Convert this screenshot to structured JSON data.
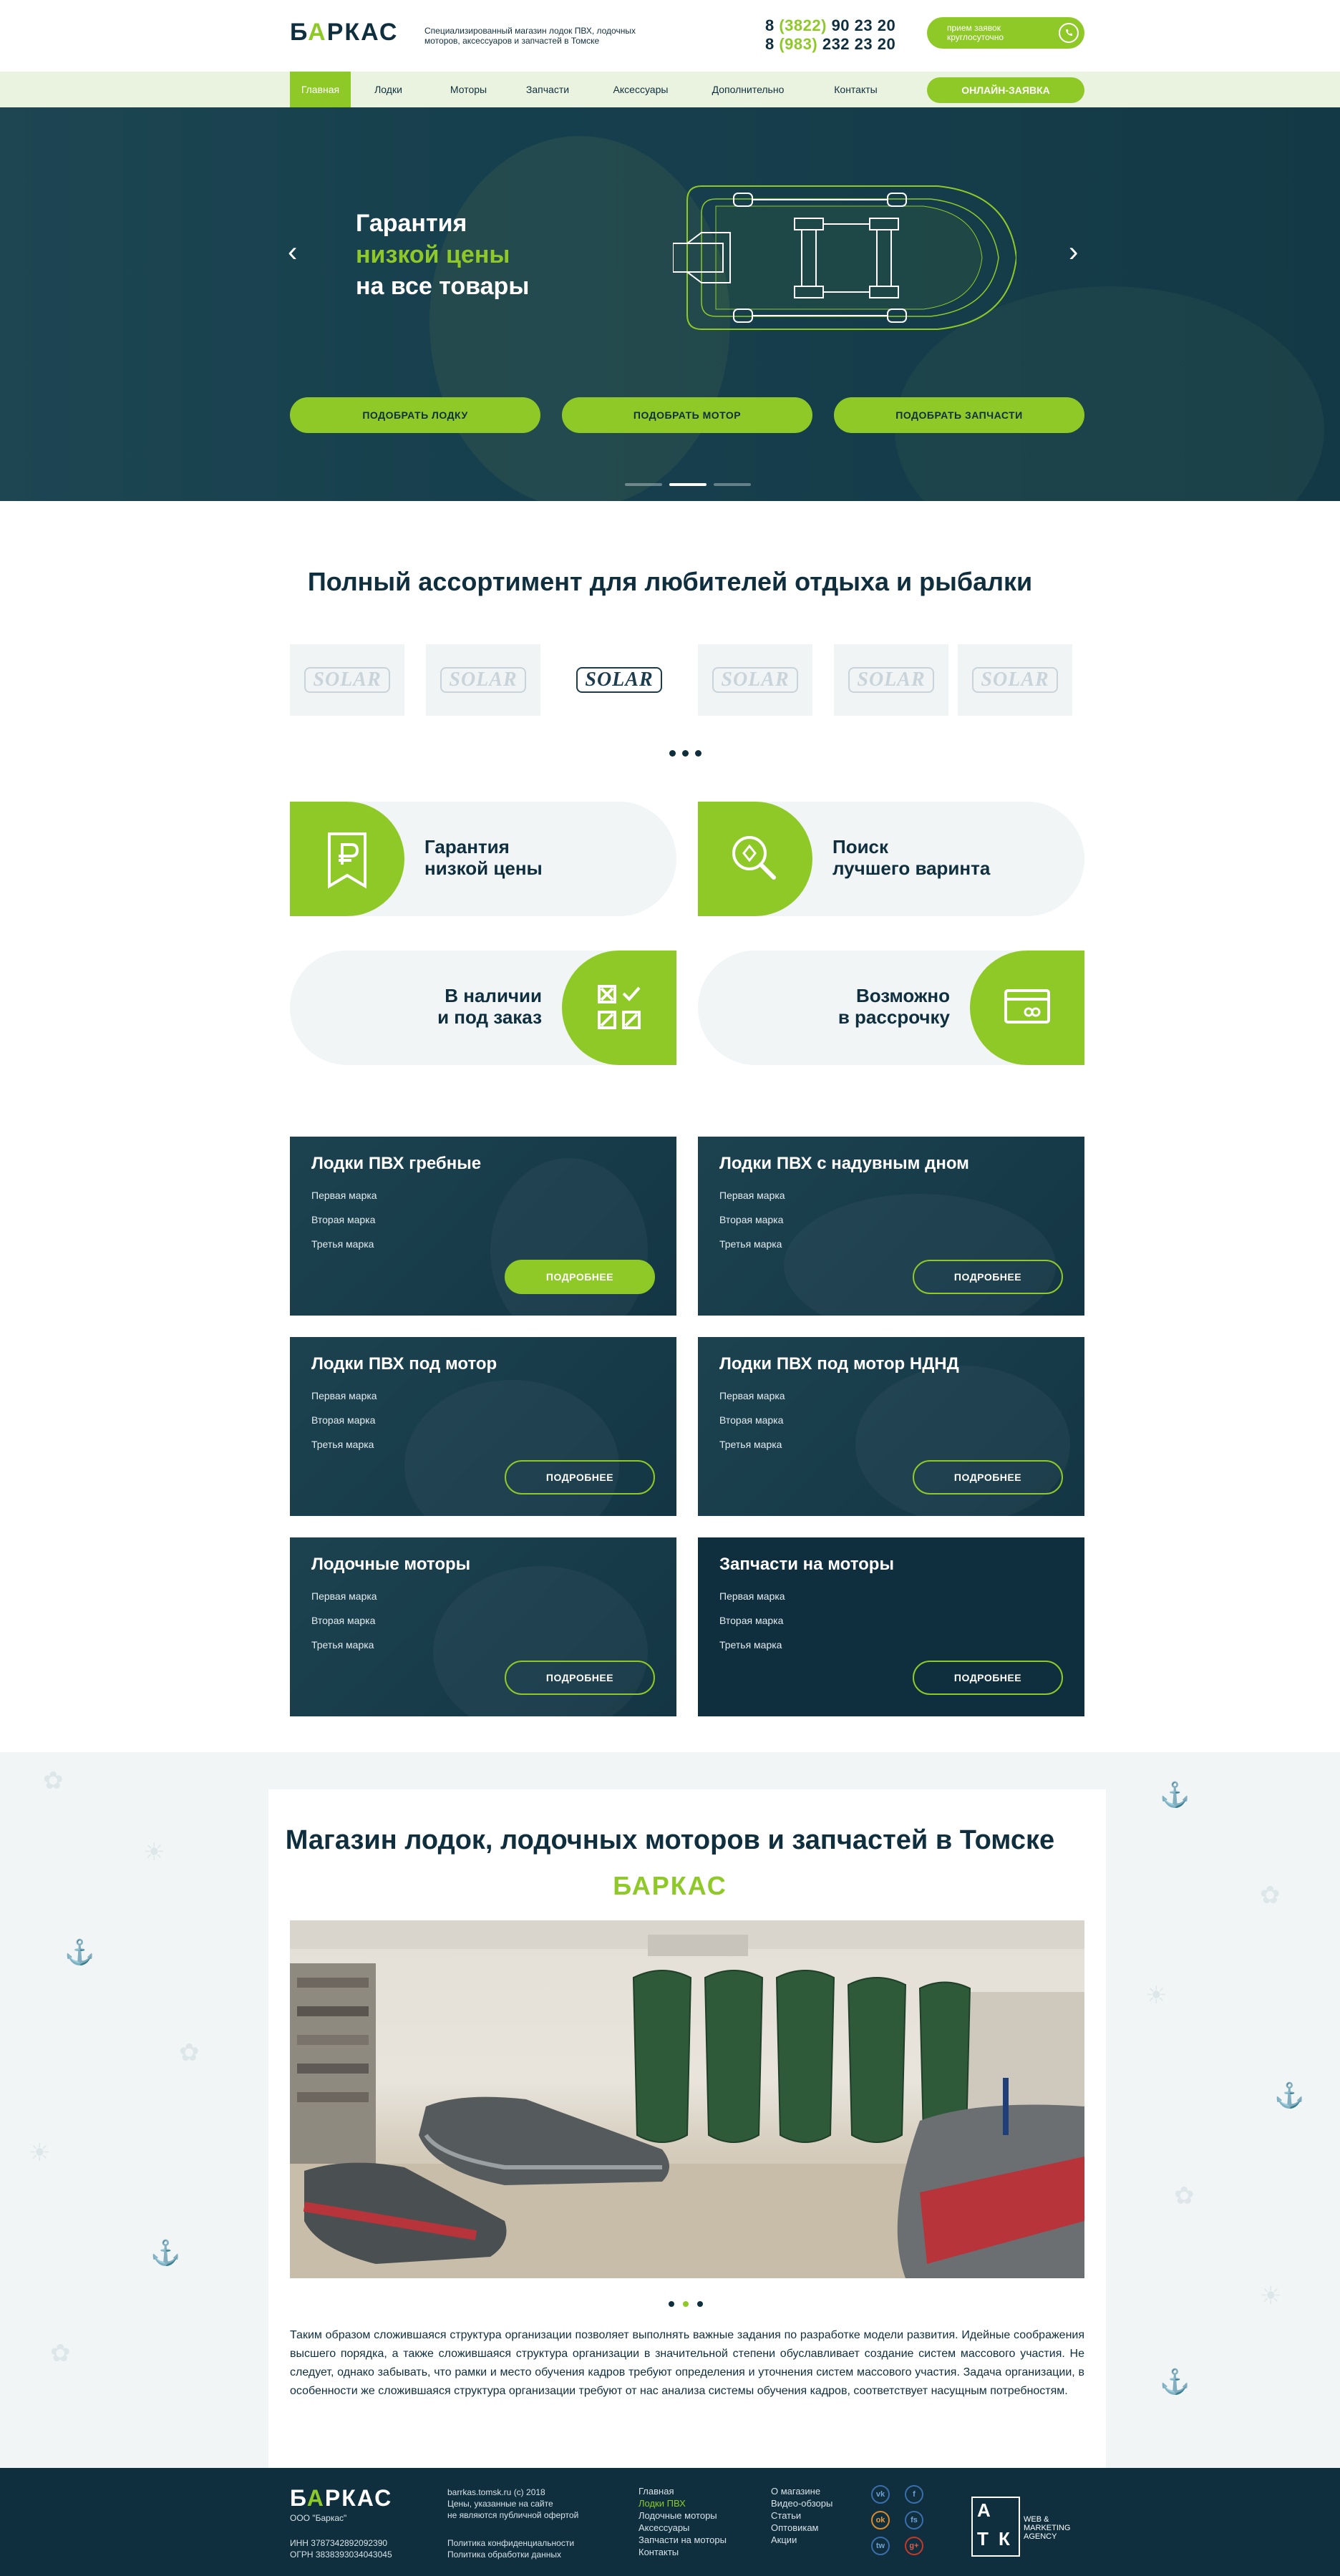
{
  "brand": {
    "logo_main": "Б",
    "logo_green": "А",
    "logo_rest": "РКАС",
    "tagline": "Специализированный магазин лодок ПВХ, лодочных моторов, аксессуаров и запчастей в Томске"
  },
  "header": {
    "phones": [
      {
        "prefix": "8 ",
        "code": "(3822)",
        "number": " 90 23 20"
      },
      {
        "prefix": "8 ",
        "code": "(983)",
        "number": " 232 23 20"
      }
    ],
    "whatsapp_label": "прием заявок круглосуточно"
  },
  "nav": {
    "items": [
      "Главная",
      "Лодки",
      "Моторы",
      "Запчасти",
      "Аксессуары",
      "Дополнительно",
      "Контакты"
    ],
    "active": "Главная",
    "order_button": "ОНЛАЙН-ЗАЯВКА"
  },
  "hero": {
    "line1": "Гарантия",
    "line2": "низкой цены",
    "line3": "на все товары",
    "buttons": [
      "ПОДОБРАТЬ ЛОДКУ",
      "ПОДОБРАТЬ МОТОР",
      "ПОДОБРАТЬ ЗАПЧАСТИ"
    ],
    "slides": 3,
    "active_slide": 2
  },
  "assortment": {
    "title": "Полный ассортимент для любителей отдыха и рыбалки",
    "brands": [
      "SOLAR",
      "SOLAR",
      "SOLAR",
      "SOLAR",
      "SOLAR",
      "SOLAR"
    ]
  },
  "features": [
    {
      "line1": "Гарантия",
      "line2": "низкой цены",
      "icon": "ruble-tag-icon"
    },
    {
      "line1": "Поиск",
      "line2": "лучшего варинта",
      "icon": "magnifier-icon"
    },
    {
      "line1": "В наличии",
      "line2": "и под заказ",
      "icon": "checklist-icon"
    },
    {
      "line1": "Возможно",
      "line2": "в рассрочку",
      "icon": "credit-card-icon"
    }
  ],
  "categories": [
    {
      "title": "Лодки ПВХ гребные",
      "items": [
        "Первая марка",
        "Вторая марка",
        "Третья марка"
      ],
      "button": "ПОДРОБНЕЕ"
    },
    {
      "title": "Лодки ПВХ с надувным дном",
      "items": [
        "Первая марка",
        "Вторая марка",
        "Третья марка"
      ],
      "button": "ПОДРОБНЕЕ"
    },
    {
      "title": "Лодки ПВХ под мотор",
      "items": [
        "Первая марка",
        "Вторая марка",
        "Третья марка"
      ],
      "button": "ПОДРОБНЕЕ"
    },
    {
      "title": "Лодки ПВХ под мотор НДНД",
      "items": [
        "Первая марка",
        "Вторая марка",
        "Третья марка"
      ],
      "button": "ПОДРОБНЕЕ"
    },
    {
      "title": "Лодочные моторы",
      "items": [
        "Первая марка",
        "Вторая марка",
        "Третья марка"
      ],
      "button": "ПОДРОБНЕЕ"
    },
    {
      "title": "Запчасти на моторы",
      "items": [
        "Первая марка",
        "Вторая марка",
        "Третья марка"
      ],
      "button": "ПОДРОБНЕЕ"
    }
  ],
  "shop": {
    "title": "Магазин лодок, лодочных моторов и запчастей в Томске",
    "logo": "БАРКАС",
    "text": "Таким образом сложившаяся структура организации позволяет выполнять важные задания по разработке модели развития. Идейные соображения высшего порядка, а также сложившаяся структура организации в значительной степени обуславливает создание систем массового участия. Не следует, однако забывать, что рамки и место обучения кадров требуют определения и уточнения систем массового участия. Задача организации, в особенности же сложившаяся структура организации требуют от нас анализа системы обучения кадров, соответствует насущным потребностям."
  },
  "footer": {
    "company": "ООО \"Баркас\"",
    "inn": "ИНН 3787342892092390",
    "ogrn": "ОГРН 3838393034043045",
    "copyright": "barrkas.tomsk.ru (c) 2018",
    "disclaimer1": "Цены, указанные на сайте",
    "disclaimer2": "не являются публичной офертой",
    "privacy": "Политика конфиденциальности",
    "data_policy": "Политика обработки данных",
    "col1": [
      "Главная",
      "Лодки ПВХ",
      "Лодочные моторы",
      "Аксессуары",
      "Запчасти на моторы",
      "Контакты"
    ],
    "col2": [
      "О магазине",
      "Видео-обзоры",
      "Статьи",
      "Оптовикам",
      "Акции"
    ],
    "col1_active": "Лодки ПВХ",
    "social": [
      "vk",
      "f",
      "ok",
      "fs",
      "tw",
      "g+"
    ],
    "agency_letters": [
      "А",
      "Т",
      "К"
    ],
    "agency_text": [
      "WEB &",
      "MARKETING",
      "AGENCY"
    ]
  },
  "colors": {
    "accent": "#8fc928",
    "dark": "#0f2f3f",
    "light": "#f2f5f5"
  }
}
